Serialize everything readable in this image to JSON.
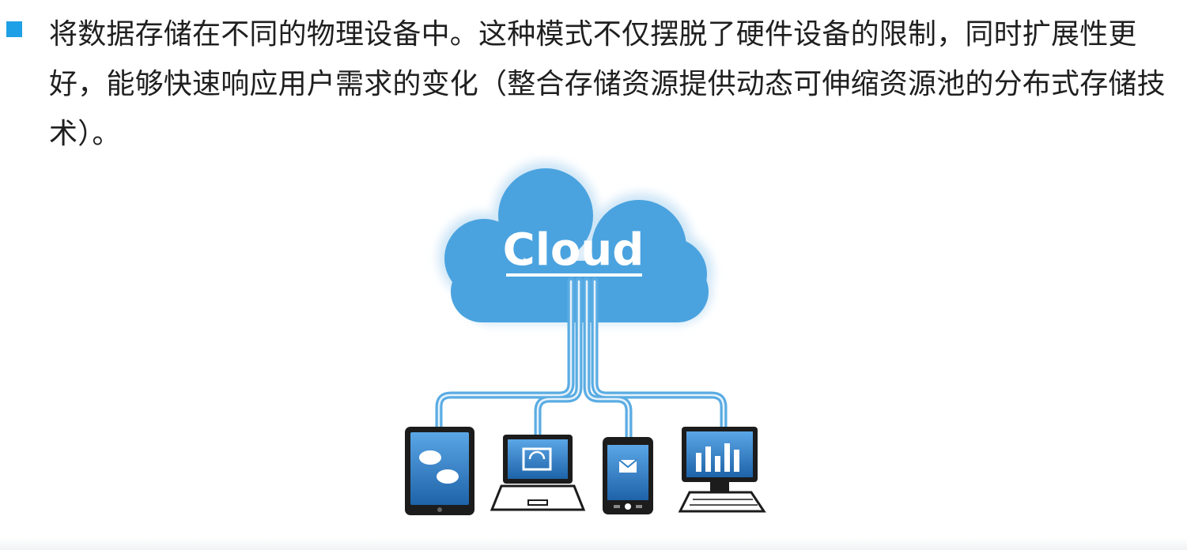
{
  "slide": {
    "bullet_text": "将数据存储在不同的物理设备中。这种模式不仅摆脱了硬件设备的限制，同时扩展性更好，能够快速响应用户需求的变化（整合存储资源提供动态可伸缩资源池的分布式存储技术）。",
    "cloud_label": "Cloud"
  },
  "colors": {
    "bullet": "#1ea0e6",
    "cloud": "#4aa3df",
    "cloud_glow": "#cfe6f7",
    "cable": "#5aace3",
    "device_body": "#1c1c1c",
    "screen": "#2f7fc6"
  },
  "icons": [
    "cloud-icon",
    "tablet-icon",
    "laptop-icon",
    "phone-icon",
    "desktop-icon"
  ]
}
